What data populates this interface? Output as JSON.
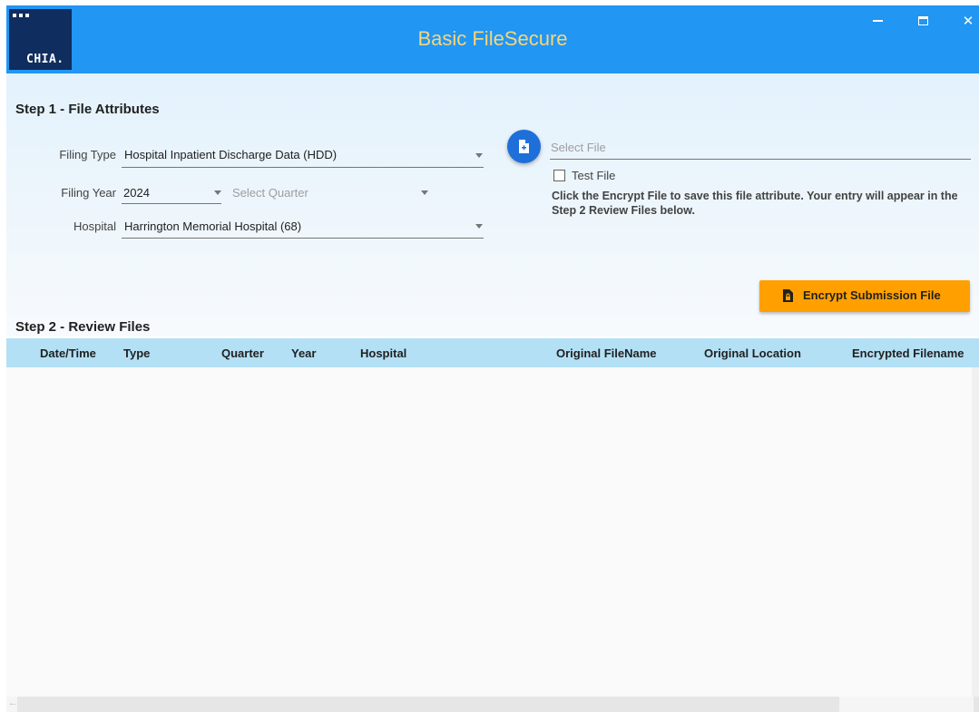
{
  "app": {
    "title": "Basic FileSecure",
    "logo_text": "CHIA."
  },
  "window_controls": {
    "close_glyph": "✕"
  },
  "step1": {
    "title": "Step 1 - File Attributes",
    "filing_type": {
      "label": "Filing Type",
      "value": "Hospital Inpatient Discharge Data (HDD)"
    },
    "filing_year": {
      "label": "Filing Year",
      "value": "2024"
    },
    "quarter": {
      "placeholder": "Select Quarter"
    },
    "hospital": {
      "label": "Hospital",
      "value": "Harrington Memorial Hospital (68)"
    },
    "select_file": {
      "placeholder": "Select File"
    },
    "test_file": {
      "label": "Test File",
      "checked": false
    },
    "info": "Click the Encrypt File to save this file attribute. Your entry will appear in the Step 2 Review Files below.",
    "encrypt_button": "Encrypt Submission File"
  },
  "step2": {
    "title": "Step 2 - Review Files",
    "columns": [
      "Date/Time",
      "Type",
      "Quarter",
      "Year",
      "Hospital",
      "Original FileName",
      "Original Location",
      "Encrypted Filename"
    ],
    "rows": []
  },
  "colors": {
    "titlebar": "#2196f3",
    "title_text": "#f7d57a",
    "logo_bg": "#0f2d5e",
    "encrypt_button": "#ffa000",
    "table_header": "#b3e0f5",
    "file_button": "#1e6fd9"
  }
}
